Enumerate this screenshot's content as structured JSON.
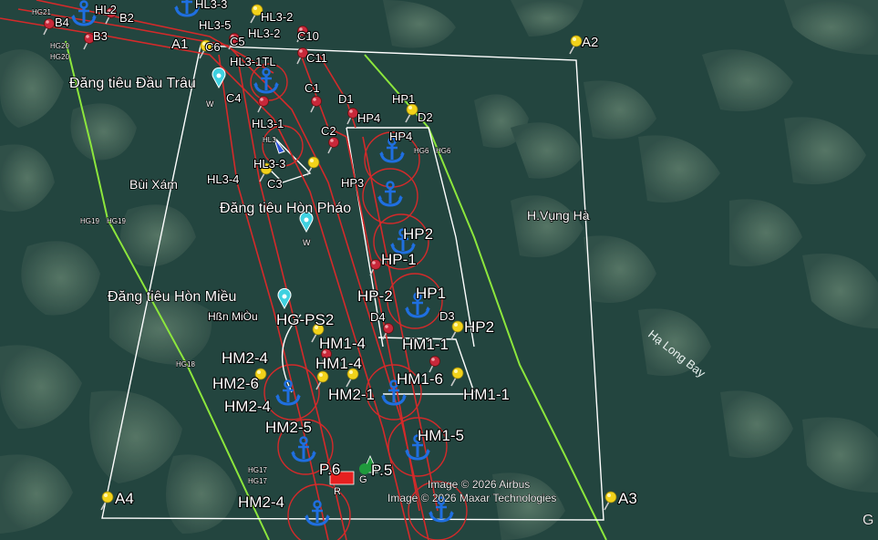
{
  "map": {
    "background": "#23453f",
    "boundary_color": "#8ce63c",
    "zone_line_color": "#ffffff",
    "channel_color": "#d42a2a",
    "pin_yellow": "#f2d21a",
    "pin_red": "#c8283a",
    "anchor_color": "#1f6fe0",
    "marker_cyan": "#3fd1e0"
  },
  "places": {
    "dang_tieu_dau_trau": "Đăng tiêu Đầu Trâu",
    "dang_tieu_hon_phao": "Đăng tiêu Hòn Pháo",
    "dang_tieu_hon_mieu": "Đăng tiêu Hòn Miều",
    "bui_xam": "Bùi Xám",
    "h_vung_ha": "H.Vụng Hà",
    "ha_long_bay": "Hạ Long Bay",
    "hon_mieu_small": "Hßn MiÒu",
    "w": "W"
  },
  "corners": {
    "a1": "A1",
    "a2": "A2",
    "a3": "A3",
    "a4": "A4"
  },
  "labels": {
    "b2": "B2",
    "b3": "B3",
    "b4": "B4",
    "hl2": "HL2",
    "hl3_3top": "HL3-3",
    "hl3_2a": "HL3-2",
    "hl3_2b": "HL3-2",
    "hl3_5": "HL3-5",
    "c5": "C5",
    "c6": "C6",
    "c10": "C10",
    "c11": "C11",
    "hl3_1tl": "HL3-1TL",
    "c4": "C4",
    "c1": "C1",
    "d1": "D1",
    "hp1_top": "HP1",
    "hp4": "HP4",
    "d2": "D2",
    "hl3_1": "HL3-1",
    "c2": "C2",
    "hp4b": "HP4",
    "hl3_3": "HL3-3",
    "hl3_4": "HL3-4",
    "c3": "C3",
    "hp3": "HP3",
    "hp2": "HP2",
    "hp_1": "HP-1",
    "hp_2": "HP-2",
    "hp1b": "HP1",
    "d3": "D3",
    "d4": "D4",
    "hp2b": "HP2",
    "hg_ps2": "HG-PS2",
    "hm1_4a": "HM1-4",
    "hm1_1a": "HM1-1",
    "hm2_4a": "HM2-4",
    "hm1_4b": "HM1-4",
    "hm2_6": "HM2-6",
    "hm1_6": "HM1-6",
    "hm2_1": "HM2-1",
    "hm1_1b": "HM1-1",
    "hm2_4b": "HM2-4",
    "hm2_5": "HM2-5",
    "hm1_5": "HM1-5",
    "p6": "P.6",
    "p5": "P.5",
    "hm2_4c": "HM2-4",
    "hl3_small": "HL3",
    "r": "R",
    "g": "G"
  },
  "small_labels": {
    "hg20a": "HG20",
    "hg20b": "HG20",
    "hg21": "HG21",
    "hg6a": "HG6",
    "hg6b": "HG6",
    "hg19a": "HG19",
    "hg19b": "HG19",
    "hg18": "HG18",
    "hg17a": "HG17",
    "hg17b": "HG17"
  },
  "attribution": {
    "line1": "Image © 2026 Airbus",
    "line2": "Image © 2026 Maxar Technologies",
    "logo": "G"
  }
}
